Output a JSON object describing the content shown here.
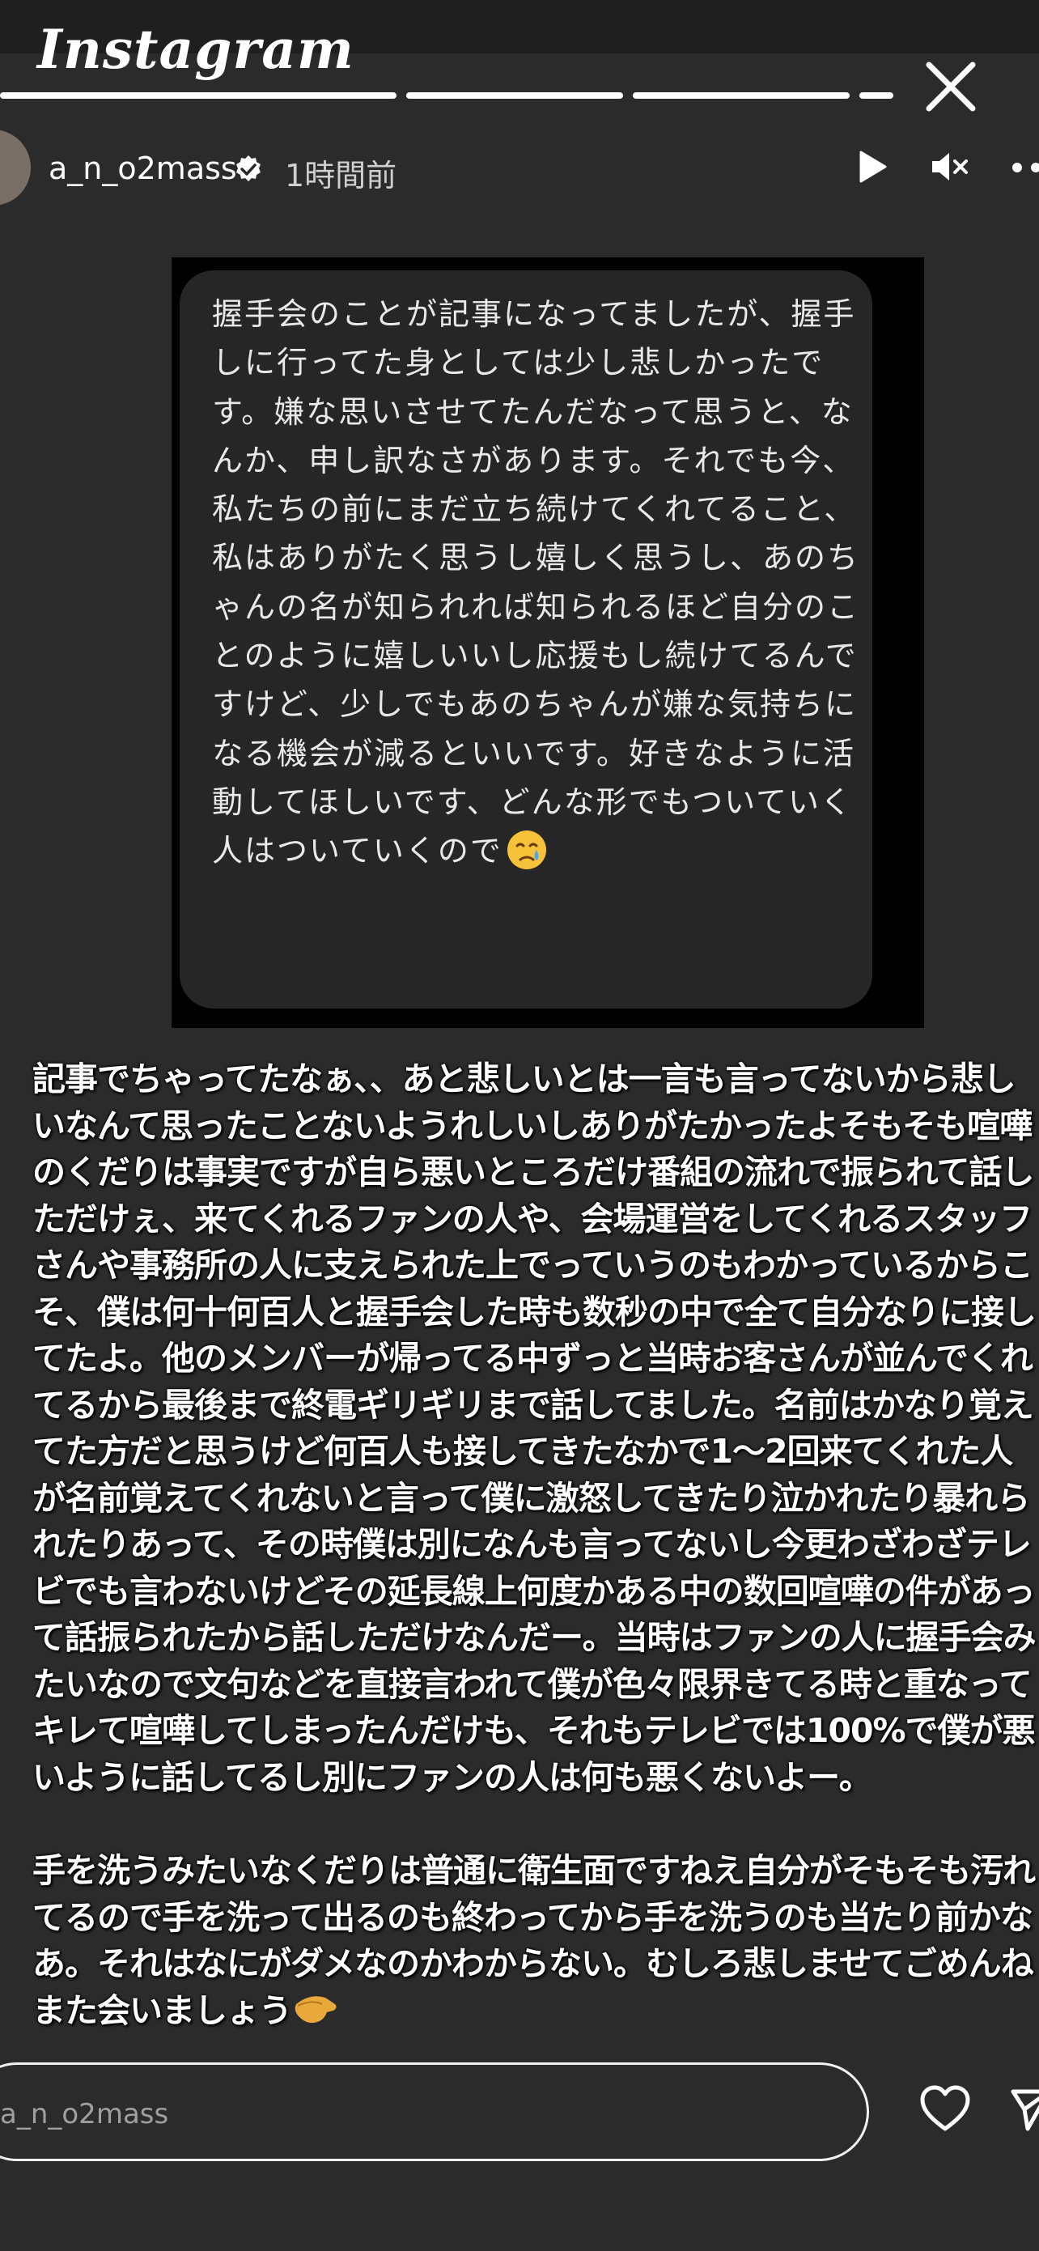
{
  "app": {
    "brand": "Instagram"
  },
  "story": {
    "progress_segments": 4,
    "active_segment": 4,
    "username": "a_n_o2mass",
    "verified": true,
    "posted_time": "1時間前"
  },
  "controls": {
    "close_icon": "close-icon",
    "play_icon": "play-icon",
    "mute_icon": "speaker-muted-icon",
    "more_icon": "more-icon"
  },
  "screenshot_message": {
    "text": "握手会のことが記事になってましたが、握手しに行ってた身としては少し悲しかったです。嫌な思いさせてたんだなって思うと、なんか、申し訳なさがあります。それでも今、私たちの前にまだ立ち続けてくれてること、私はありがたく思うし嬉しく思うし、あのちゃんの名が知られれば知られるほど自分のことのように嬉しいいし応援もし続けてるんですけど、少しでもあのちゃんが嫌な気持ちになる機会が減るといいです。好きなように活動してほしいです、どんな形でもついていく人はついていくので",
    "emoji": "crying-face-emoji"
  },
  "reply": {
    "paragraph1": "記事でちゃってたなぁ、、あと悲しいとは一言も言ってないから悲しいなんて思ったことないようれしいしありがたかったよそもそも喧嘩のくだりは事実ですが自ら悪いところだけ番組の流れで振られて話しただけぇ、来てくれるファンの人や、会場運営をしてくれるスタッフさんや事務所の人に支えられた上でっていうのもわかっているからこそ、僕は何十何百人と握手会した時も数秒の中で全て自分なりに接してたよ。他のメンバーが帰ってる中ずっと当時お客さんが並んでくれてるから最後まで終電ギリギリまで話してました。名前はかなり覚えてた方だと思うけど何百人も接してきたなかで1〜2回来てくれた人が名前覚えてくれないと言って僕に激怒してきたり泣かれたり暴れられたりあって、その時僕は別になんも言ってないし今更わざわざテレビでも言わないけどその延長線上何度かある中の数回喧嘩の件があって話振られたから話しただけなんだー。当時はファンの人に握手会みたいなので文句などを直接言われて僕が色々限界きてる時と重なってキレて喧嘩してしまったんだけも、それもテレビでは100%で僕が悪いように話してるし別にファンの人は何も悪くないよー。",
    "paragraph2": "手を洗うみたいなくだりは普通に衛生面ですねえ自分がそもそも汚れてるので手を洗って出るのも終わってから手を洗うのも当たり前かなあ。それはなにがダメなのかわからない。むしろ悲しませてごめんねまた会いましょう",
    "emoji": "hand-emoji"
  },
  "bottom_bar": {
    "reply_placeholder": "a_n_o2mass",
    "heart_icon": "heart-icon",
    "send_icon": "send-icon"
  }
}
